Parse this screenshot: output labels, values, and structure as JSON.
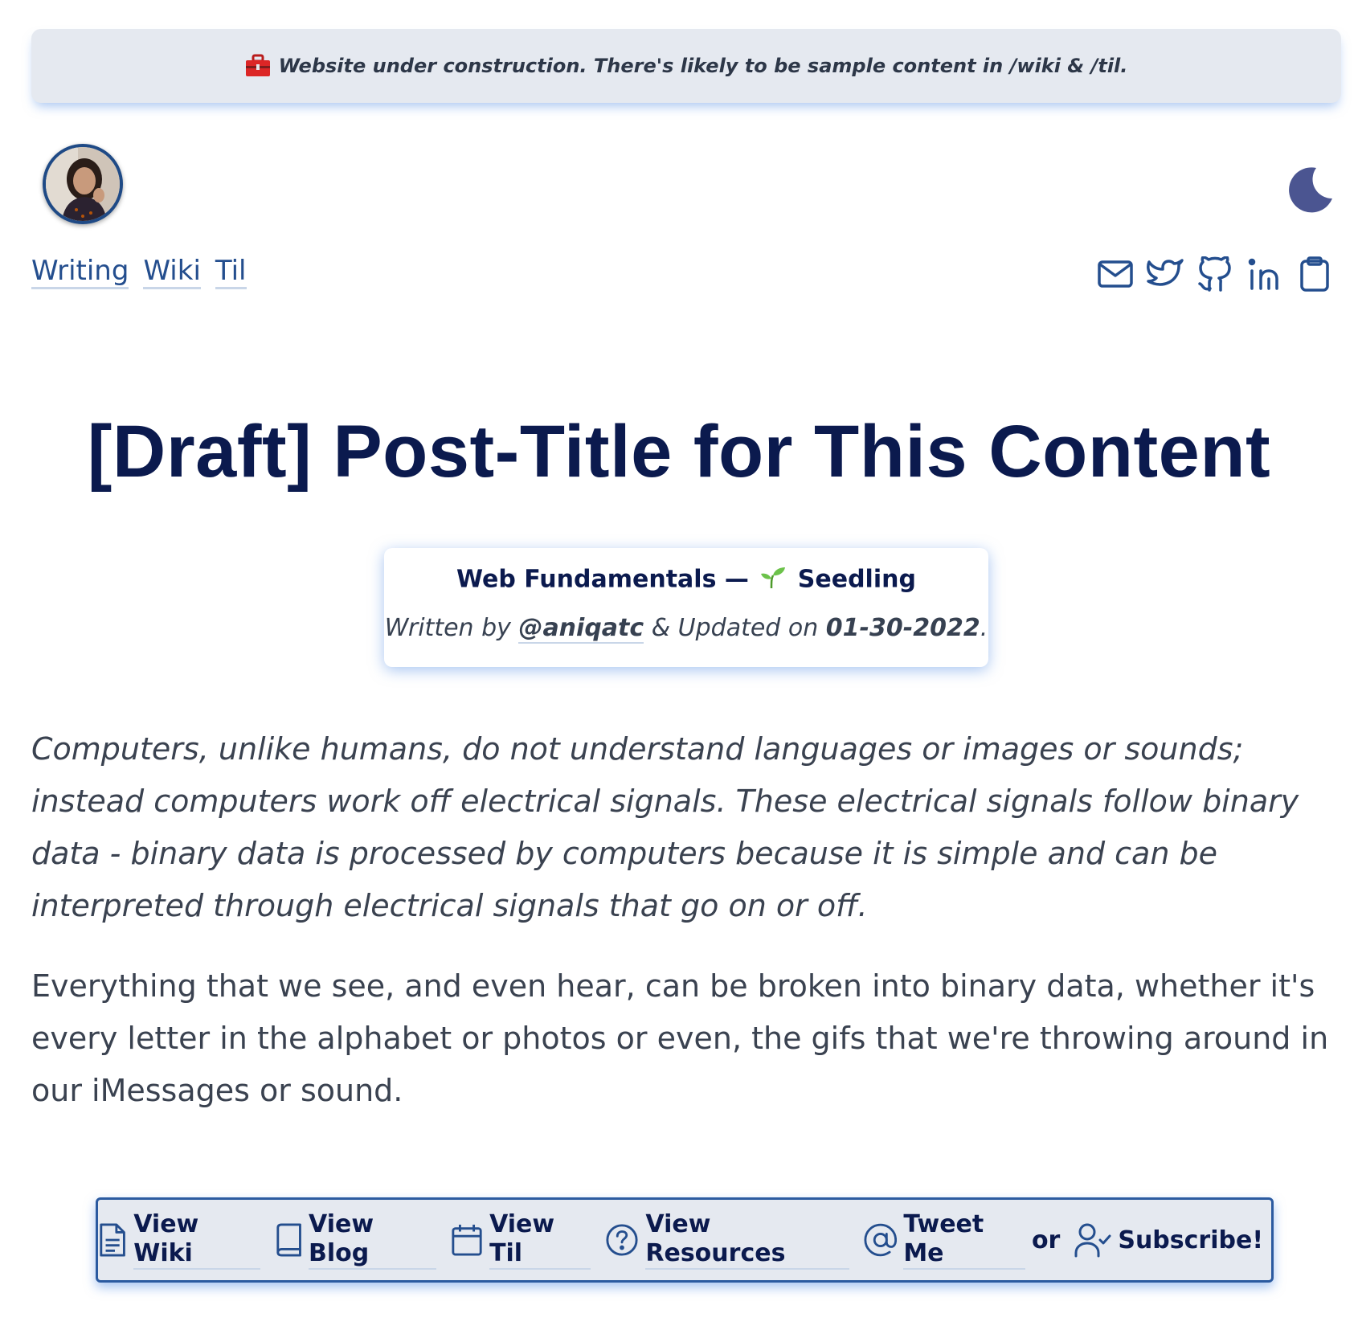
{
  "banner": {
    "icon": "toolbox-icon",
    "text": "Website under construction. There's likely to be sample content in /wiki & /til."
  },
  "header": {
    "avatar": "avatar",
    "theme_toggle_icon": "moon-icon",
    "nav": [
      {
        "label": "Writing"
      },
      {
        "label": "Wiki"
      },
      {
        "label": "Til"
      }
    ],
    "social_icons": [
      "mail-icon",
      "twitter-icon",
      "github-icon",
      "linkedin-icon",
      "clipboard-icon"
    ]
  },
  "post": {
    "title": "[Draft] Post-Title for This Content",
    "series": "Web Fundamentals —",
    "status": "Seedling",
    "written_by": "Written by",
    "author": "@aniqatc",
    "updated_on": "& Updated on",
    "date": "01-30-2022",
    "period": ".",
    "paragraphs": [
      "Computers, unlike humans, do not understand languages or images or sounds; instead computers work off electrical signals. These electrical signals follow binary data - binary data is processed by computers because it is simple and can be interpreted through electrical signals that go on or off.",
      "Everything that we see, and even hear, can be broken into binary data, whether it's every letter in the alphabet or photos or even, the gifs that we're throwing around in our iMessages or sound."
    ]
  },
  "footer": {
    "view_wiki": "View Wiki",
    "view_blog": "View Blog",
    "view_til": "View Til",
    "view_resources": "View Resources",
    "tweet_me": "Tweet Me",
    "or": "or",
    "subscribe": "Subscribe!"
  },
  "colors": {
    "accent": "#244e8e",
    "title": "#0b1a4e",
    "banner_bg": "#e5e9f0",
    "glow": "#6096e6"
  }
}
